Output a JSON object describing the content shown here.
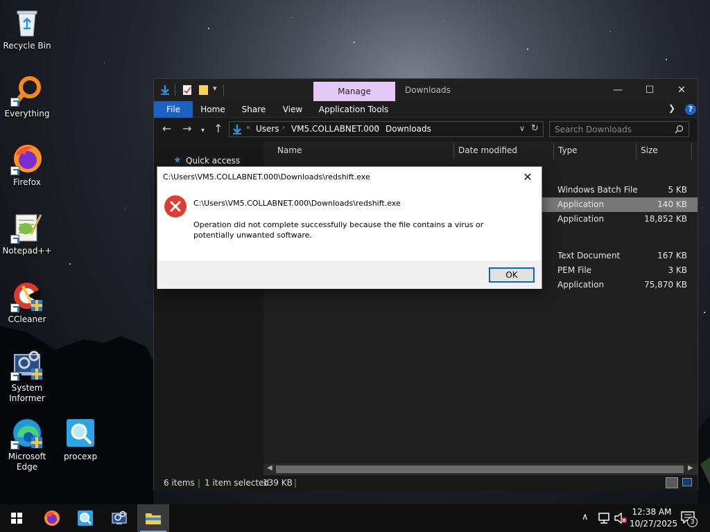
{
  "desktop": {
    "icons": [
      {
        "label": "Recycle Bin",
        "icon": "recycle-bin-icon"
      },
      {
        "label": "Everything",
        "icon": "everything-search-icon"
      },
      {
        "label": "Firefox",
        "icon": "firefox-icon"
      },
      {
        "label": "Notepad++",
        "icon": "notepad-plus-plus-icon"
      },
      {
        "label": "CCleaner",
        "icon": "ccleaner-icon"
      },
      {
        "label": "System\nInformer",
        "icon": "system-informer-icon"
      },
      {
        "label": "Microsoft\nEdge",
        "icon": "microsoft-edge-icon"
      },
      {
        "label": "procexp",
        "icon": "process-explorer-icon"
      }
    ]
  },
  "explorer": {
    "title": "Downloads",
    "context_tab": "Manage",
    "ribbon_tabs": [
      "File",
      "Home",
      "Share",
      "View",
      "Application Tools"
    ],
    "window_controls": {
      "minimize": "—",
      "maximize": "☐",
      "close": "✕"
    },
    "breadcrumb": [
      "Users",
      "VM5.COLLABNET.000",
      "Downloads"
    ],
    "search_placeholder": "Search Downloads",
    "nav_pane": {
      "quick_access": "Quick access"
    },
    "columns": [
      "Name",
      "Date modified",
      "Type",
      "Size"
    ],
    "files": [
      {
        "type": "Windows Batch File",
        "size": "5 KB",
        "selected": false
      },
      {
        "type": "Application",
        "size": "140 KB",
        "selected": true
      },
      {
        "type": "Application",
        "size": "18,852 KB",
        "selected": false
      },
      {
        "type": "Text Document",
        "size": "167 KB",
        "selected": false
      },
      {
        "type": "PEM File",
        "size": "3 KB",
        "selected": false
      },
      {
        "type": "Application",
        "size": "75,870 KB",
        "selected": false
      }
    ],
    "status": {
      "item_count": "6 items",
      "selection": "1 item selected",
      "selection_size": "139 KB"
    }
  },
  "dialog": {
    "title": "C:\\Users\\VM5.COLLABNET.000\\Downloads\\redshift.exe",
    "heading": "C:\\Users\\VM5.COLLABNET.000\\Downloads\\redshift.exe",
    "message": "Operation did not complete successfully because the file contains a virus or potentially unwanted software.",
    "ok_label": "OK",
    "close_glyph": "✕"
  },
  "taskbar": {
    "pinned": [
      "start-icon",
      "firefox-icon",
      "process-explorer-icon",
      "system-informer-icon",
      "file-explorer-icon"
    ],
    "clock": {
      "time": "12:38 AM",
      "date": "10/27/2025"
    },
    "notification_count": "3"
  },
  "colors": {
    "accent": "#1c62c4",
    "manage_tab": "#e3c8f6",
    "error_red": "#e03c31",
    "selected_row": "#777777"
  }
}
